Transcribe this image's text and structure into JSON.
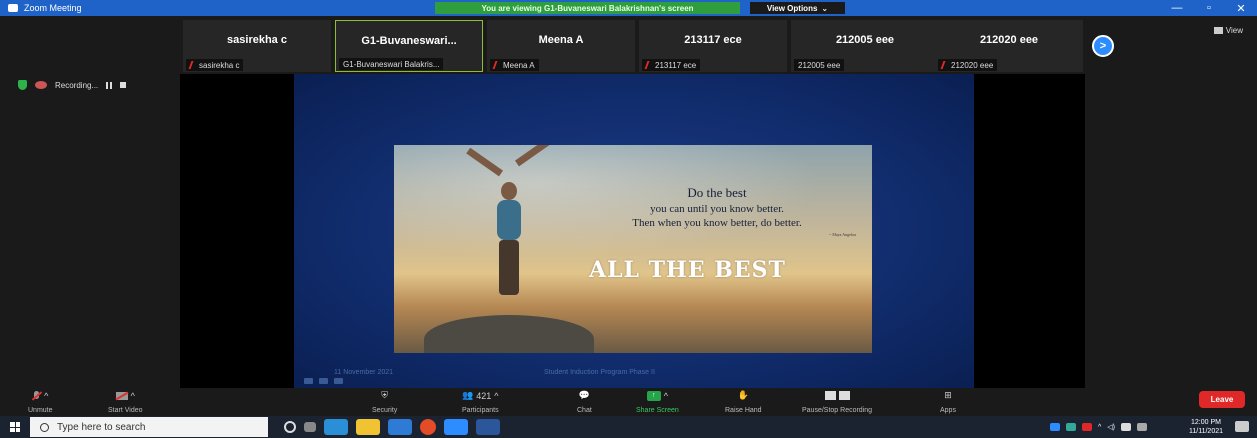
{
  "window": {
    "title": "Zoom Meeting",
    "viewing_banner": "You are viewing G1-Buvaneswari Balakrishnan's screen",
    "view_options": "View Options",
    "min_glyph": "—",
    "max_glyph": "▫",
    "close_glyph": "✕"
  },
  "gallery": {
    "tiles": [
      {
        "display": "sasirekha c",
        "label": "sasirekha c",
        "muted": true,
        "active": false
      },
      {
        "display": "G1-Buvaneswari...",
        "label": "G1-Buvaneswari Balakris...",
        "muted": false,
        "active": true
      },
      {
        "display": "Meena A",
        "label": "Meena A",
        "muted": true,
        "active": false
      },
      {
        "display": "213117 ece",
        "label": "213117 ece",
        "muted": true,
        "active": false
      },
      {
        "display": "212005 eee",
        "label": "212005 eee",
        "muted": false,
        "active": false
      },
      {
        "display": "212020 eee",
        "label": "212020 eee",
        "muted": true,
        "active": false
      }
    ],
    "next_glyph": ">",
    "view_label": "View"
  },
  "recording": {
    "label": "Recording..."
  },
  "slide": {
    "quote_line1": "Do the best",
    "quote_line2": "you can until you know better.",
    "quote_line3": "Then when you know better, do better.",
    "quote_author": "~ Maya Angelou",
    "headline": "ALL THE BEST",
    "footer_date": "11 November 2021",
    "footer_program": "Student Induction Program Phase II"
  },
  "controls": {
    "unmute": "Unmute",
    "start_video": "Start Video",
    "security": "Security",
    "participants": "Participants",
    "participants_count": "421",
    "chat": "Chat",
    "share_screen": "Share Screen",
    "raise_hand": "Raise Hand",
    "pause_stop": "Pause/Stop Recording",
    "apps": "Apps",
    "leave": "Leave",
    "caret": "^"
  },
  "taskbar": {
    "search_placeholder": "Type here to search",
    "time": "12:00 PM",
    "date": "11/11/2021",
    "icons": [
      "cortana-icon",
      "task-view-icon",
      "edge-icon",
      "file-explorer-icon",
      "store-icon",
      "chrome-icon",
      "zoom-icon",
      "word-icon"
    ],
    "colors": {
      "edge": "#2b8fd8",
      "explorer": "#f1c232",
      "store": "#2d7bd4",
      "chrome": "#e34c26",
      "zoom": "#2d8cff",
      "word": "#2b579a"
    }
  }
}
